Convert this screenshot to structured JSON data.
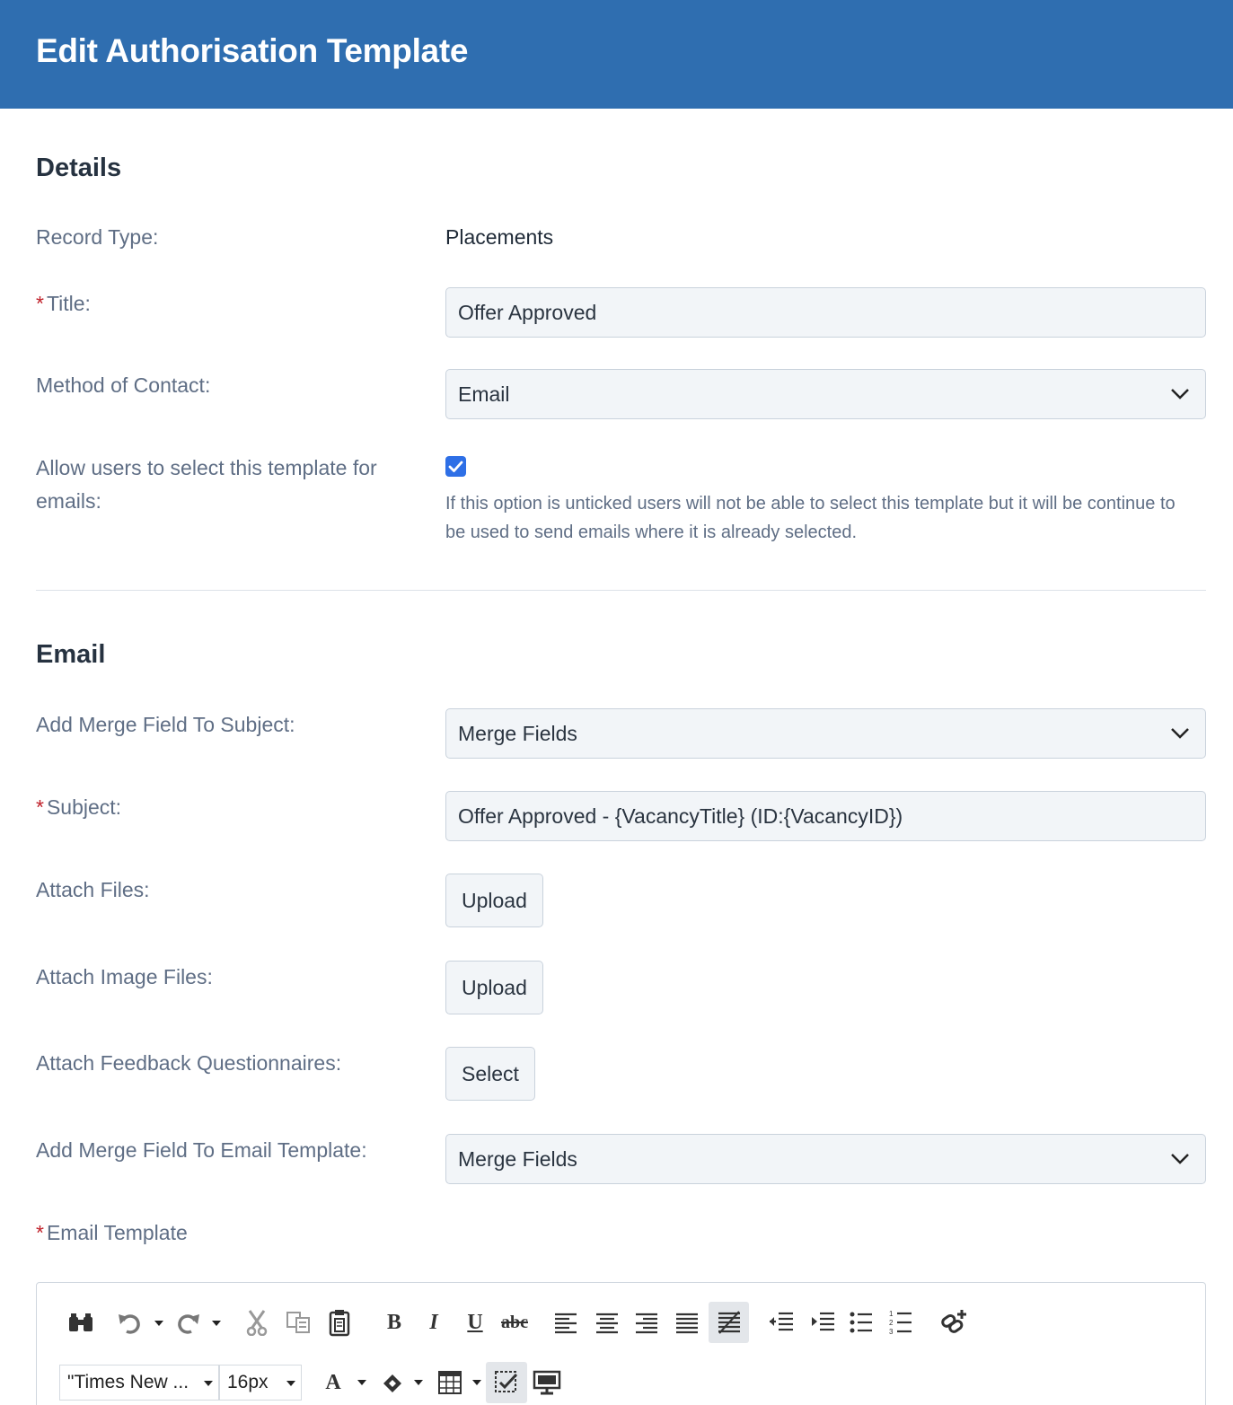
{
  "header": {
    "title": "Edit Authorisation Template"
  },
  "details": {
    "heading": "Details",
    "record_type_label": "Record Type:",
    "record_type_value": "Placements",
    "title_required": "*",
    "title_label": "Title:",
    "title_value": "Offer Approved",
    "method_label": "Method of Contact:",
    "method_value": "Email",
    "allow_label": "Allow users to select this template for emails:",
    "allow_checked": true,
    "allow_help": "If this option is unticked users will not be able to select this template but it will be continue to be used to send emails where it is already selected."
  },
  "email": {
    "heading": "Email",
    "merge_subject_label": "Add Merge Field To Subject:",
    "merge_subject_value": "Merge Fields",
    "subject_required": "*",
    "subject_label": "Subject:",
    "subject_value": "Offer Approved - {VacancyTitle} (ID:{VacancyID})",
    "attach_files_label": "Attach Files:",
    "attach_files_button": "Upload",
    "attach_images_label": "Attach Image Files:",
    "attach_images_button": "Upload",
    "attach_questionnaires_label": "Attach Feedback Questionnaires:",
    "attach_questionnaires_button": "Select",
    "merge_template_label": "Add Merge Field To Email Template:",
    "merge_template_value": "Merge Fields",
    "template_required": "*",
    "template_label": "Email Template"
  },
  "editor": {
    "toolbar_row1": [
      "find-icon",
      "undo-icon",
      "redo-icon",
      "cut-icon",
      "copy-icon",
      "paste-icon",
      "bold-icon",
      "italic-icon",
      "underline-icon",
      "strikethrough-icon",
      "align-left-icon",
      "align-center-icon",
      "align-right-icon",
      "justify-icon",
      "clear-format-icon",
      "outdent-icon",
      "indent-icon",
      "bullet-list-icon",
      "numbered-list-icon",
      "link-icon"
    ],
    "bold_glyph": "B",
    "italic_glyph": "I",
    "underline_glyph": "U",
    "strike_glyph": "abc",
    "font_family": "\"Times New ...",
    "font_size": "16px",
    "font_color_glyph": "A",
    "toolbar_row2": [
      "font-color-icon",
      "highlight-icon",
      "table-icon",
      "spellcheck-icon",
      "preview-icon"
    ]
  },
  "colors": {
    "header_bg": "#2f6eb0",
    "label": "#5f6e85",
    "required": "#c0222b",
    "checkbox": "#2e6fe6"
  }
}
